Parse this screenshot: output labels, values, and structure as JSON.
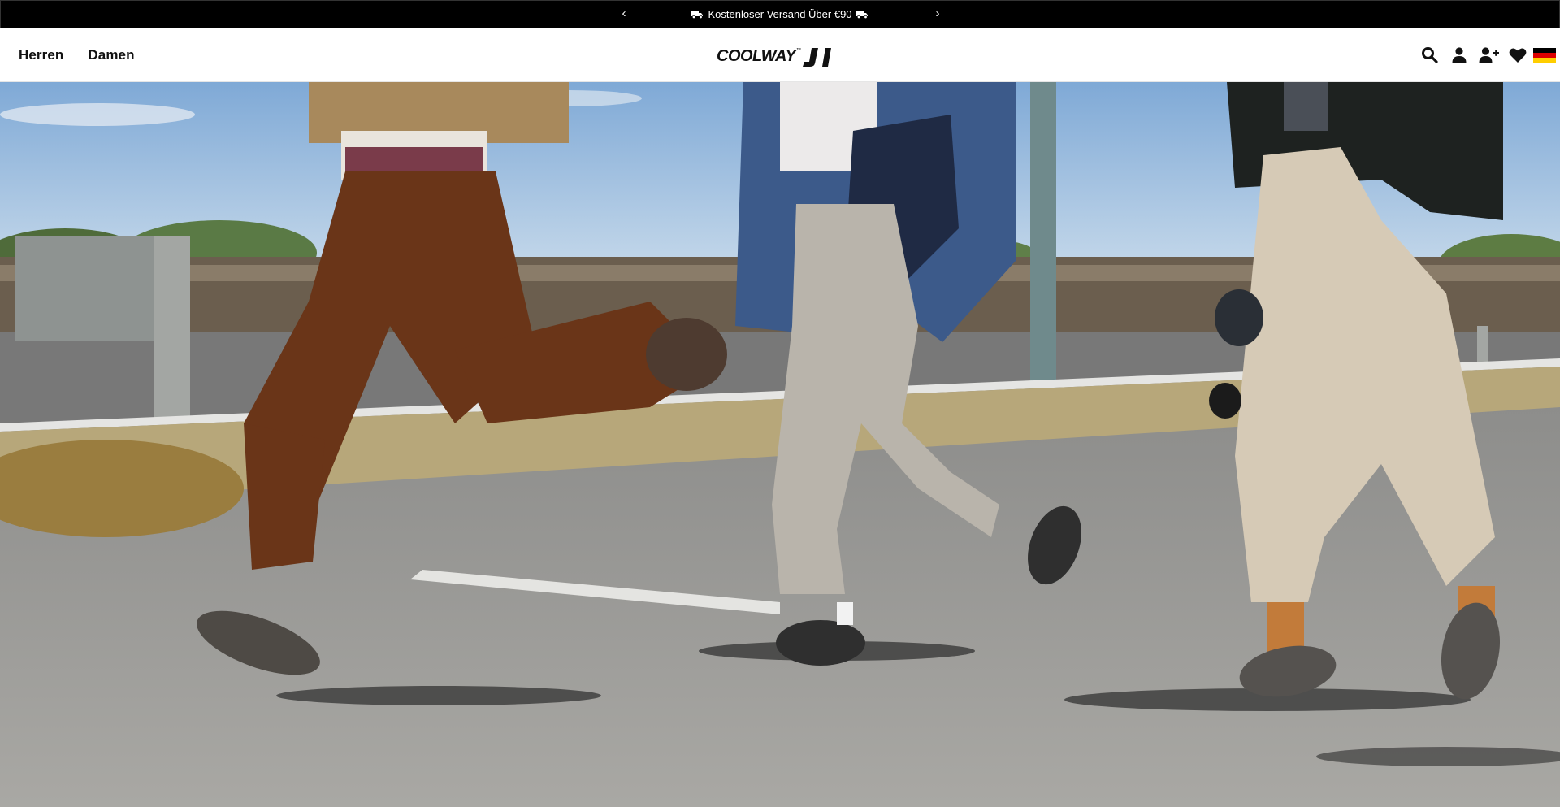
{
  "announcement": {
    "prev_label": "‹",
    "next_label": "›",
    "message": "Kostenloser Versand Über €90",
    "icon_left": "truck-icon",
    "icon_right": "truck-icon"
  },
  "header": {
    "nav": [
      {
        "label": "Herren"
      },
      {
        "label": "Damen"
      }
    ],
    "logo_text": "COOLWAY",
    "logo_tm": "™",
    "icons": [
      "search-icon",
      "account-icon",
      "add-user-icon",
      "heart-icon",
      "flag-de-icon"
    ]
  },
  "hero": {
    "image": "hero-photo: three people running on roadside wearing sneakers"
  },
  "colors": {
    "announcement_bg": "#000000",
    "header_bg": "#ffffff",
    "text": "#111111"
  }
}
